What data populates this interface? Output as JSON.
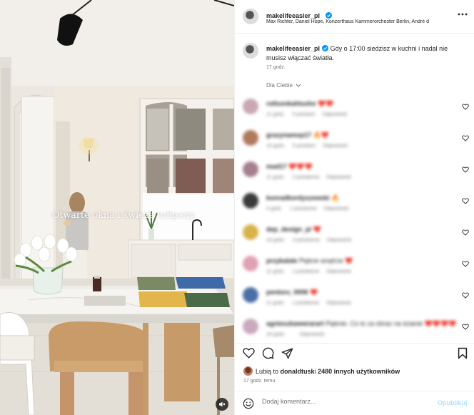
{
  "media": {
    "overlay_text": "Otwarte okna i świeże tulipany."
  },
  "header": {
    "username": "makelifeeasier_pl",
    "audio": "Max Richter, Daniel Hope, Konzerthaus Kammerorchester Berlin, André d"
  },
  "caption": {
    "username": "makelifeeasier_pl",
    "text": "Gdy o 17:00 siedzisz w kuchni i nadal nie musisz włączać światła.",
    "time": "17 godz."
  },
  "comments_filter": {
    "label": "Dla Ciebie"
  },
  "comments": [
    {
      "user": "rollsonkahlusho",
      "text": "❤️❤️",
      "time": "11 godz.",
      "likes": "5 polubień",
      "reply": "Odpowiedz",
      "avatar_color": "#c9a7b3"
    },
    {
      "user": "grazynamop17",
      "text": "🔥❤️",
      "time": "10 godz.",
      "likes": "5 polubień",
      "reply": "Odpowiedz",
      "avatar_color": "#b07a5e"
    },
    {
      "user": "mad17",
      "text": "❤️❤️❤️",
      "time": "11 godz.",
      "likes": "2 polubienia",
      "reply": "Odpowiedz",
      "avatar_color": "#a57f8e"
    },
    {
      "user": "konradkordyszewski",
      "text": "🔥",
      "time": "4 godz.",
      "likes": "1 polubienie",
      "reply": "Odpowiedz",
      "avatar_color": "#3a3a3a"
    },
    {
      "user": "dep_design_pl",
      "text": "❤️",
      "time": "16 godz.",
      "likes": "3 polubienia",
      "reply": "Odpowiedz",
      "avatar_color": "#d8b14a"
    },
    {
      "user": "przykalale",
      "text": "Piękne wnętrze ❤️",
      "time": "11 godz.",
      "likes": "1 polubienie",
      "reply": "Odpowiedz",
      "avatar_color": "#e2a1b5"
    },
    {
      "user": "pentoru_0006",
      "text": "❤️",
      "time": "11 godz.",
      "likes": "1 polubienie",
      "reply": "Odpowiedz",
      "avatar_color": "#4a6fa5"
    },
    {
      "user": "agnieszkawwrarart",
      "text": "Pięknie. Co to za obraz na ścianie ❤️❤️❤️❤️",
      "time": "16 godz.",
      "likes": "",
      "reply": "Odpowiedz",
      "avatar_color": "#caa9bf"
    }
  ],
  "actions": {
    "like_icon": "heart-icon",
    "comment_icon": "comment-icon",
    "share_icon": "share-icon",
    "save_icon": "bookmark-icon"
  },
  "likes": {
    "prefix": "Lubią to ",
    "user": "donaldtusk",
    "middle": " i ",
    "others": "2480 innych użytkowników"
  },
  "post_time": "17 godz. temu",
  "composer": {
    "placeholder": "Dodaj komentarz...",
    "publish_label": "Opublikuj"
  },
  "colors": {
    "verified": "#0095f6",
    "publish_disabled": "#b2dffc",
    "secondary_text": "#737373"
  }
}
